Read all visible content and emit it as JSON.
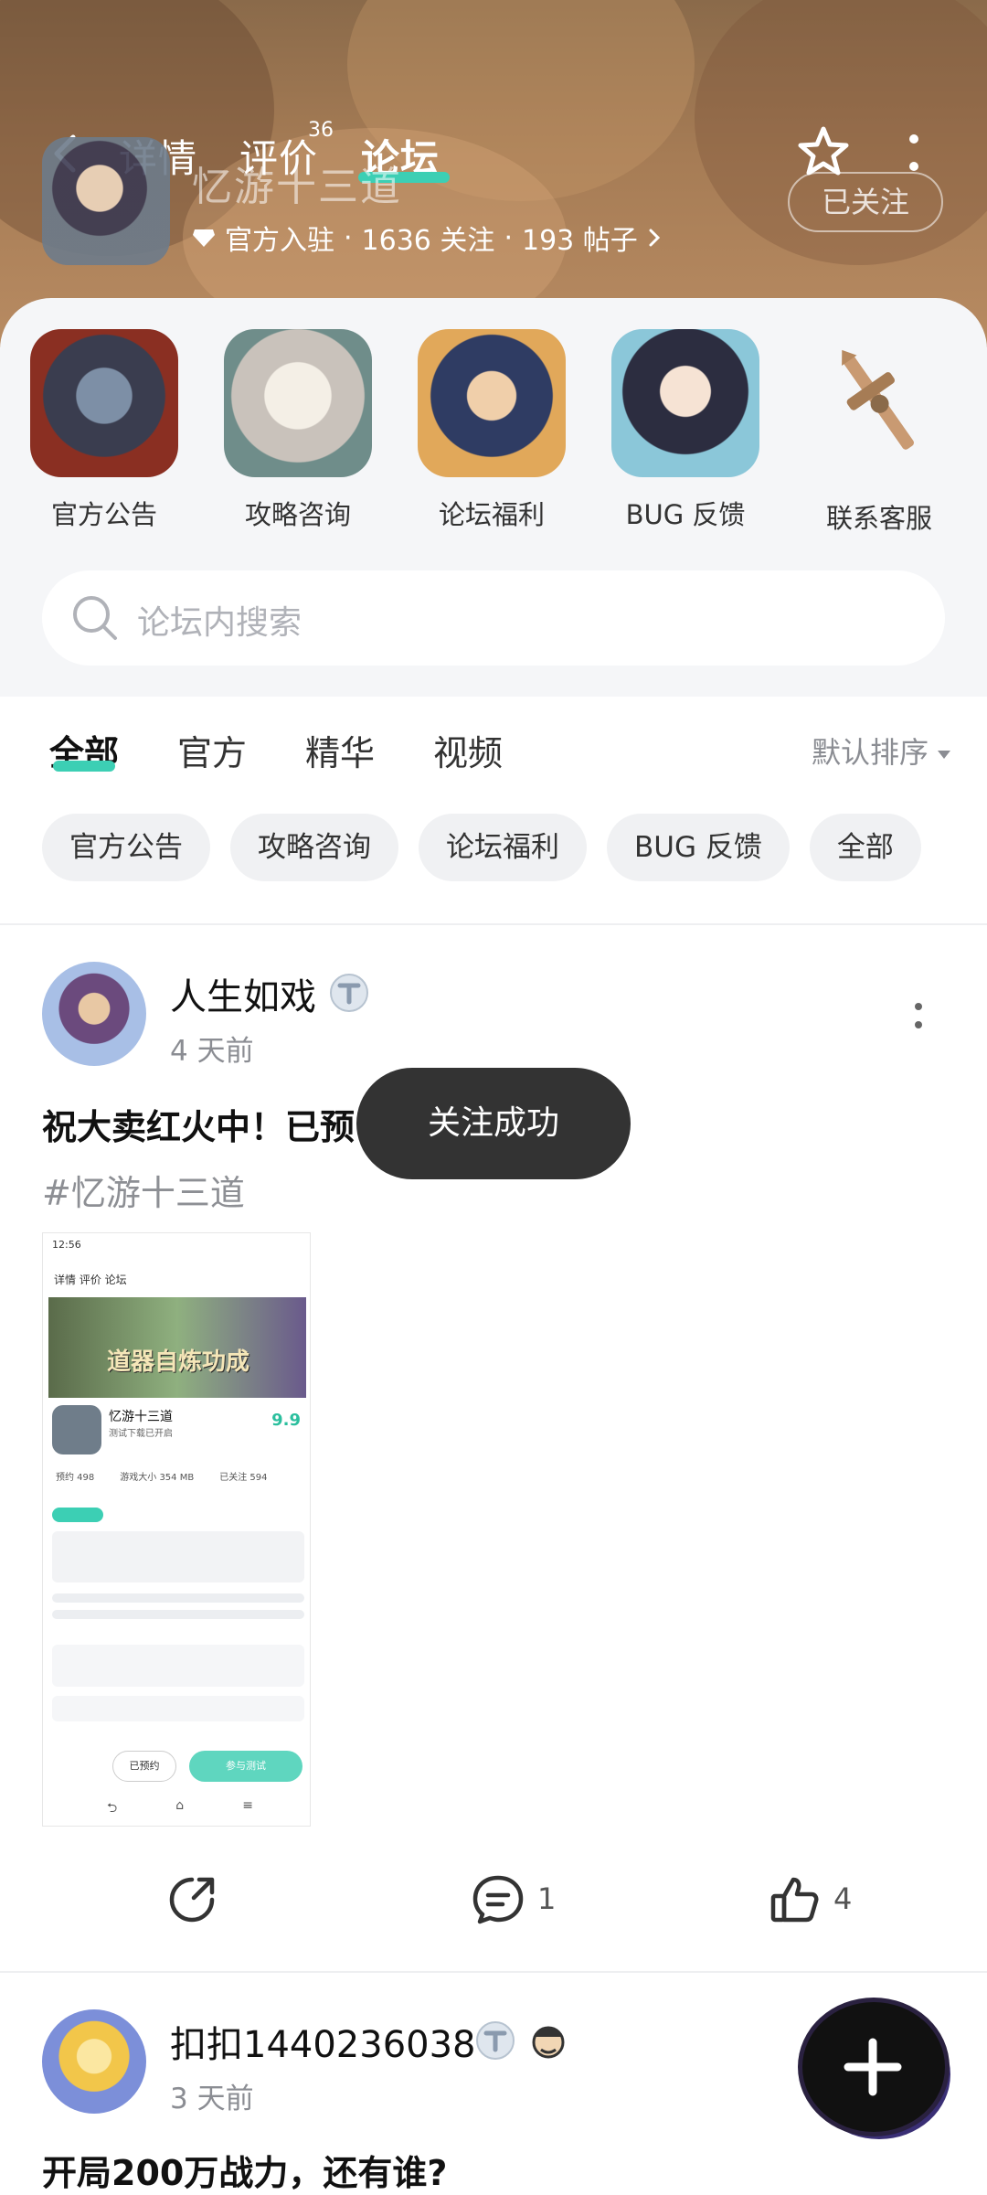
{
  "header": {
    "tabs": [
      {
        "label": "详情"
      },
      {
        "label": "评价",
        "count": "36"
      },
      {
        "label": "论坛"
      }
    ],
    "game_name": "忆游十三道",
    "followed_label": "已关注",
    "official": "官方入驻",
    "meta_follow": "1636 关注",
    "meta_posts": "193 帖子",
    "dot": "·",
    "accent_color": "#3ccfb4"
  },
  "categories": [
    {
      "label": "官方公告"
    },
    {
      "label": "攻略咨询"
    },
    {
      "label": "论坛福利"
    },
    {
      "label": "BUG 反馈"
    },
    {
      "label": "联系客服"
    }
  ],
  "search": {
    "placeholder": "论坛内搜索"
  },
  "filter_tabs": [
    {
      "label": "全部"
    },
    {
      "label": "官方"
    },
    {
      "label": "精华"
    },
    {
      "label": "视频"
    }
  ],
  "sort_label": "默认排序",
  "chips": [
    {
      "label": "官方公告"
    },
    {
      "label": "攻略咨询"
    },
    {
      "label": "论坛福利"
    },
    {
      "label": "BUG 反馈"
    },
    {
      "label": "全部"
    }
  ],
  "posts": [
    {
      "username": "人生如戏",
      "time": "4 天前",
      "title": "祝大卖红火中！已预",
      "hashtag": "#忆游十三道",
      "comments": "1",
      "likes": "4",
      "screenshot": {
        "status_time": "12:56",
        "nav": "详情  评价  论坛",
        "banner": "道器自炼功成",
        "game": "忆游十三道",
        "sub": "测试下载已开启",
        "score": "9.9",
        "stat1": "预约 498",
        "stat2": "游戏大小 354 MB",
        "stat3": "已关注 594",
        "reserved": "已预约",
        "join": "参与测试"
      }
    },
    {
      "username": "扣扣1440236038",
      "time": "3 天前",
      "title": "开局200万战力，还有谁?"
    }
  ],
  "toast": "关注成功"
}
